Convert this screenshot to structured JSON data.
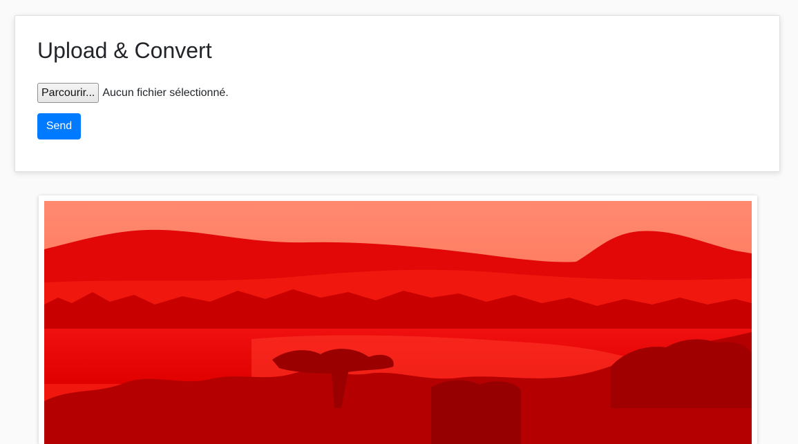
{
  "form": {
    "title": "Upload & Convert",
    "browse_label": "Parcourir...",
    "file_status": "Aucun fichier sélectionné.",
    "send_label": "Send"
  },
  "colors": {
    "primary": "#007bff",
    "image_tint": "#ff0000"
  },
  "icons": {
    "photo": "landscape-photo"
  }
}
